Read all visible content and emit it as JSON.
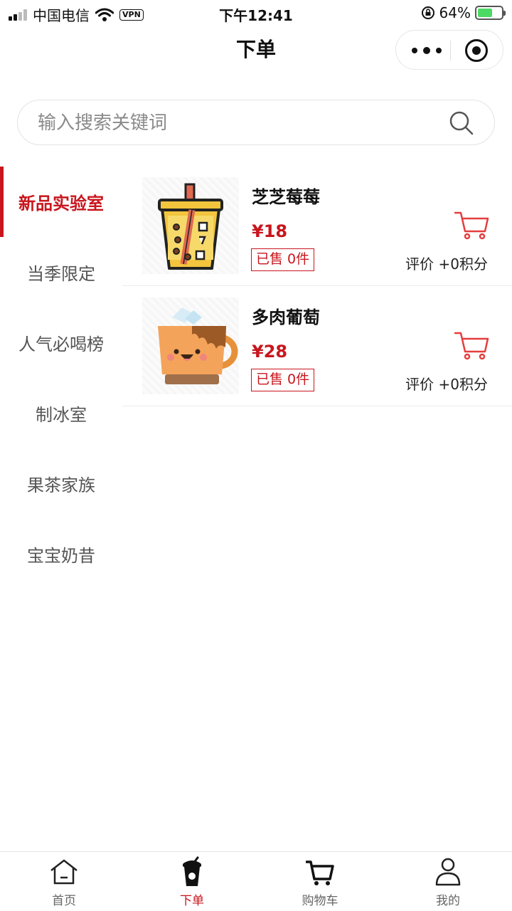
{
  "status_bar": {
    "carrier": "中国电信",
    "vpn": "VPN",
    "time": "下午12:41",
    "battery": "64%",
    "battery_level": 0.64
  },
  "nav": {
    "title": "下单"
  },
  "search": {
    "placeholder": "输入搜索关键词"
  },
  "sidebar": {
    "items": [
      {
        "label": "新品实验室",
        "active": true
      },
      {
        "label": "当季限定"
      },
      {
        "label": "人气必喝榜"
      },
      {
        "label": "制冰室"
      },
      {
        "label": "果茶家族"
      },
      {
        "label": "宝宝奶昔"
      }
    ]
  },
  "products": [
    {
      "name": "芝芝莓莓",
      "price": "¥18",
      "sold": "已售 0件",
      "rating": "评价 +0积分",
      "image": "bubble-tea-cup"
    },
    {
      "name": "多肉葡萄",
      "price": "¥28",
      "sold": "已售 0件",
      "rating": "评价 +0积分",
      "image": "smiling-mug"
    }
  ],
  "tabbar": {
    "tabs": [
      {
        "label": "首页",
        "icon": "home-icon"
      },
      {
        "label": "下单",
        "icon": "drink-cup-icon",
        "active": true
      },
      {
        "label": "购物车",
        "icon": "cart-icon"
      },
      {
        "label": "我的",
        "icon": "user-icon"
      }
    ]
  },
  "colors": {
    "accent": "#c8161d",
    "battery": "#4cd964"
  }
}
